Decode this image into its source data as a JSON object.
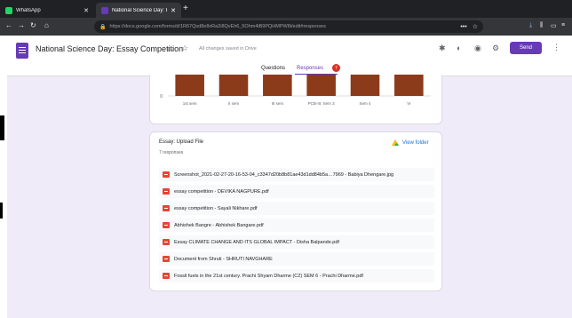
{
  "browser": {
    "tabs": [
      {
        "label": "WhatsApp",
        "color": "#25d366"
      },
      {
        "label": "National Science Day: Essay C",
        "color": "#673ab7"
      }
    ],
    "url": "https://docs.google.com/forms/d/1R67Qsd8e8xRa2i8QvEh6_5Ohm4iB9PQHMPW8i/edit#responses",
    "zoom_icon": "more-horizontal-icon"
  },
  "form": {
    "title": "National Science Day: Essay Competition",
    "saved_status": "All changes saved in Drive",
    "send_label": "Send",
    "tabs": [
      "Questions",
      "Responses"
    ],
    "response_badge": "7"
  },
  "chart_data": {
    "type": "bar",
    "categories": [
      "1st sem",
      "II sem",
      "III sem",
      "PCB-III: Sem 3",
      "Sem 4",
      "VI"
    ],
    "values": [
      1,
      1,
      1,
      1,
      1,
      1
    ],
    "y_tick_visible": "0",
    "color": "#8b3a1a"
  },
  "upload": {
    "title": "Essay: Upload File",
    "count": "7 responses",
    "view_folder": "View folder",
    "files": [
      "Screenshot_2021-02-27-20-16-53-04_c3347d20b8b81ae43d1dd84b5a…7969 - Babiya Dhengare.jpg",
      "essay competition - DEVIKA NAGPURE.pdf",
      "essay competition - Sayali Nikhare.pdf",
      "Abhishek Bangre - Abhishek Bangare.pdf",
      "Essay CLIMATE CHANGE AND ITS GLOBAL IMPACT - Disha Balpande.pdf",
      "Document from Shruti - SHRUTI NAVGHARE",
      "Fossil fuels in the 21st century. Prachi Shyam Dharme (C2) SEM 6 - Prachi Dharme.pdf"
    ]
  }
}
